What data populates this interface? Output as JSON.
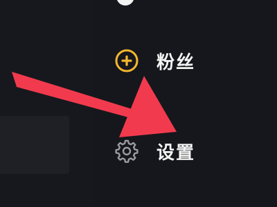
{
  "menu": {
    "items": [
      {
        "label": "粉丝",
        "icon": "fans-plus-icon",
        "icon_color": "#f5b82e"
      },
      {
        "label": "设置",
        "icon": "gear-icon",
        "icon_color": "#9a9ba0"
      }
    ]
  },
  "annotation": {
    "arrow_color": "#f23a4e"
  }
}
